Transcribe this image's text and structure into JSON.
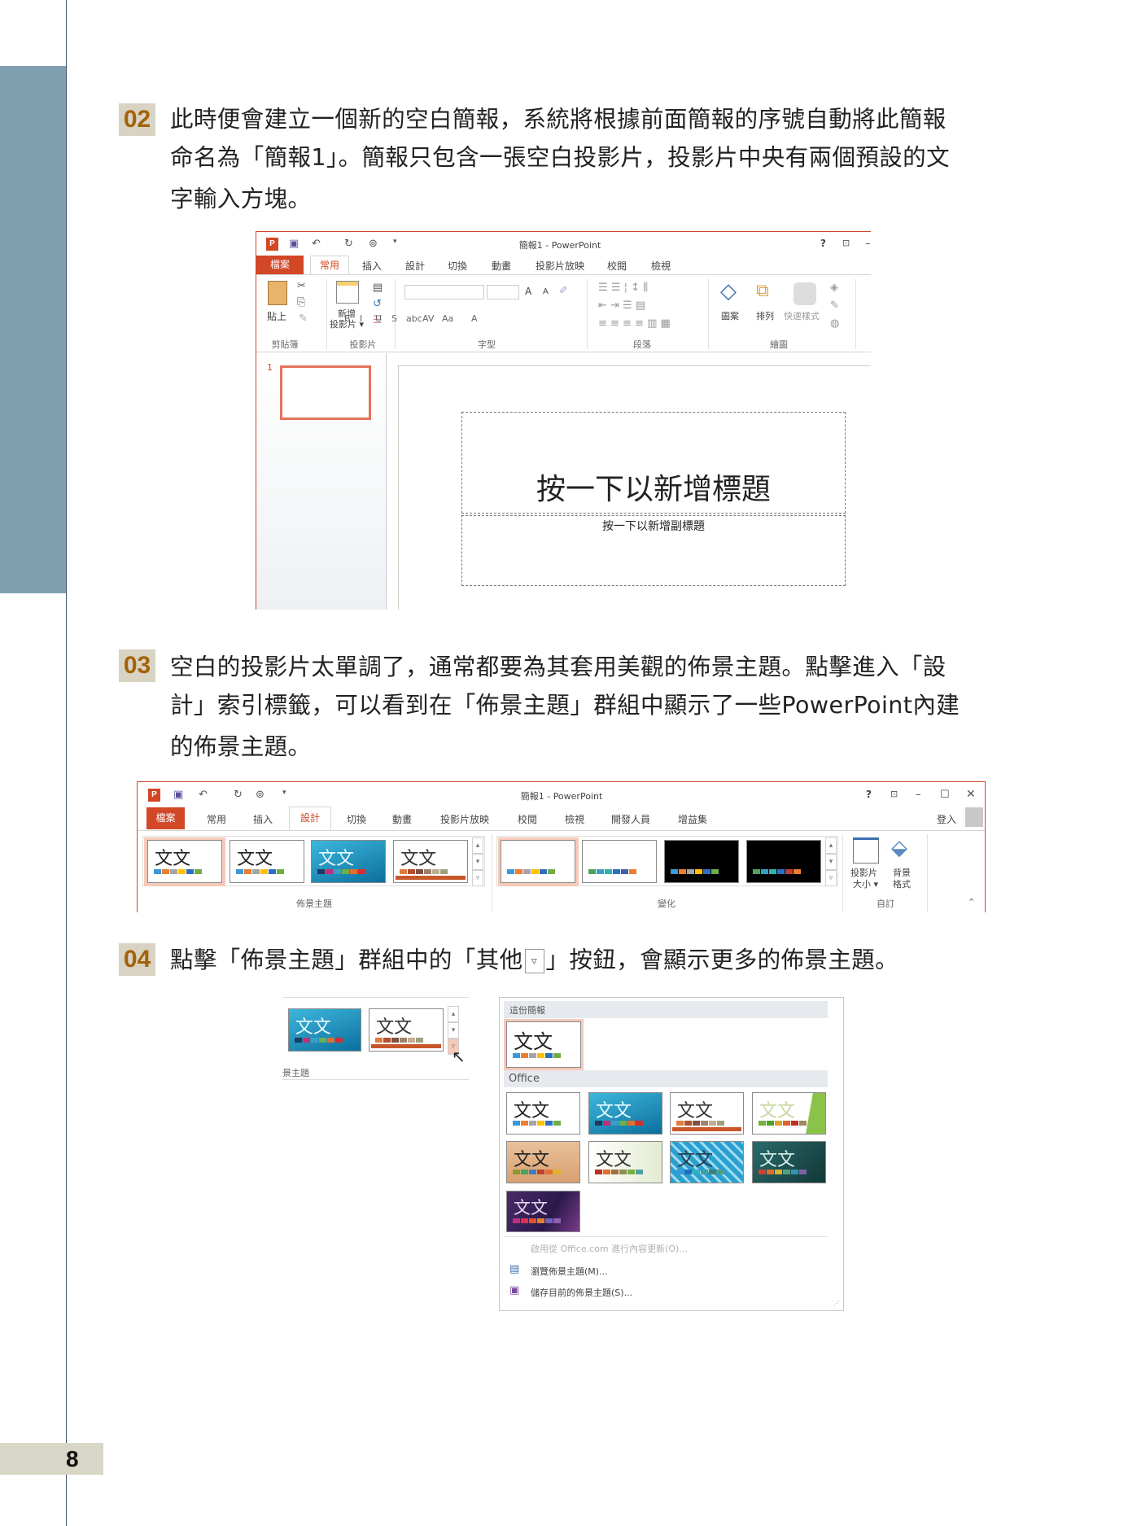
{
  "page_number": "8",
  "steps": [
    {
      "num": "02",
      "lines": [
        "此時便會建立一個新的空白簡報，系統將根據前面簡報的序號自動將此簡報",
        "命名為「簡報1」。簡報只包含一張空白投影片，投影片中央有兩個預設的文",
        "字輸入方塊。"
      ]
    },
    {
      "num": "03",
      "lines": [
        "空白的投影片太單調了，通常都要為其套用美觀的佈景主題。點擊進入「設",
        "計」索引標籤，可以看到在「佈景主題」群組中顯示了一些PowerPoint內建",
        "的佈景主題。"
      ]
    },
    {
      "num": "04",
      "before": "點擊「佈景主題」群組中的「其他",
      "more_icon": "▿",
      "after": "」按鈕，會顯示更多的佈景主題。"
    }
  ],
  "window1": {
    "title": "簡報1 - PowerPoint",
    "help": "?",
    "tabs": [
      "檔案",
      "常用",
      "插入",
      "設計",
      "切換",
      "動畫",
      "投影片放映",
      "校閱",
      "檢視"
    ],
    "active_tab": "常用",
    "ribbon": {
      "paste": "貼上",
      "new_slide_1": "新增",
      "new_slide_2": "投影片 ▾",
      "font_buttons": [
        "B",
        "I",
        "U",
        "S",
        "abc",
        "AV",
        "Aa",
        "A"
      ],
      "grow": "A",
      "shrink": "A",
      "shapes": "圖案",
      "arrange": "排列",
      "quick_styles": "快速樣式",
      "groups": [
        "剪貼簿",
        "投影片",
        "字型",
        "段落",
        "繪圖"
      ]
    },
    "slide_number": "1",
    "title_placeholder": "按一下以新增標題",
    "subtitle_placeholder": "按一下以新增副標題"
  },
  "window2": {
    "title": "簡報1 - PowerPoint",
    "help": "?",
    "tabs": [
      "檔案",
      "常用",
      "插入",
      "設計",
      "切換",
      "動畫",
      "投影片放映",
      "校閱",
      "檢視",
      "開發人員",
      "增益集"
    ],
    "active_tab": "設計",
    "sign_in": "登入",
    "slide_size_1": "投影片",
    "slide_size_2": "大小 ▾",
    "bg_format_1": "背景",
    "bg_format_2": "格式",
    "groups": [
      "佈景主題",
      "變化",
      "自訂"
    ]
  },
  "theme_label": "文文",
  "themes": {
    "office": {
      "bg": "#ffffff",
      "fg": "#222222",
      "sw": [
        "#3a9ad9",
        "#ed7d31",
        "#a5a5a5",
        "#ffc000",
        "#2f6fc0",
        "#70ad47"
      ]
    },
    "facet": {
      "bg": "linear-gradient(160deg,#3db7dc,#0c6f9e)",
      "fg": "#e6fbff",
      "sw": [
        "#1f3a5f",
        "#c0307a",
        "#3aa0c0",
        "#6bb04a",
        "#e07030",
        "#d03030"
      ]
    },
    "integral": {
      "bg": "#ffffff",
      "fg": "#333333",
      "sw": [
        "#e07a40",
        "#b05030",
        "#805040",
        "#a08070",
        "#c0b090",
        "#a0a080"
      ],
      "bar": "#c8582a"
    },
    "ion": {
      "bg": "linear-gradient(100deg,#ffffff 75%,#8bc34a 76%)",
      "fg": "#c8d8a0",
      "sw": [
        "#7ab040",
        "#50a030",
        "#e0a030",
        "#e06030",
        "#c03020",
        "#9a8a60"
      ]
    },
    "wood": {
      "bg": "linear-gradient(#e9c09a,#d9a070)",
      "fg": "#222222",
      "sw": [
        "#8a9a30",
        "#50a060",
        "#3a80c0",
        "#c04030",
        "#e07030",
        "#e0b030"
      ]
    },
    "retrospect": {
      "bg": "linear-gradient(90deg,#ffffff,#e3ebd0)",
      "fg": "#333333",
      "sw": [
        "#c03020",
        "#e07030",
        "#a07040",
        "#8a9050",
        "#7ab040",
        "#50a0a0"
      ]
    },
    "organic": {
      "bg": "repeating-linear-gradient(45deg,#2aa0d0 0 6px,#9fdcf0 6px 9px)",
      "fg": "#2a3a4a",
      "sw": [
        "#3a9ad9",
        "#1f70c0",
        "#30b0c0",
        "#40a0a0",
        "#408070",
        "#50a080"
      ]
    },
    "teal": {
      "bg": "linear-gradient(135deg,#2a6a6a,#123838)",
      "fg": "#d8eee8",
      "sw": [
        "#d04030",
        "#e07030",
        "#e0b030",
        "#50a080",
        "#3a90b0",
        "#8060a0"
      ]
    },
    "purple": {
      "bg": "linear-gradient(120deg,#4a2a6a,#2a1a4a 60%,#7a3a8a)",
      "fg": "#e8d8f0",
      "sw": [
        "#c03080",
        "#e03050",
        "#e05030",
        "#e08030",
        "#7060c0",
        "#9060b0"
      ]
    },
    "var1": {
      "bg": "#ffffff",
      "fg": "#222222",
      "sw": [
        "#3a9ad9",
        "#ed7d31",
        "#a5a5a5",
        "#ffc000",
        "#2f6fc0",
        "#70ad47"
      ],
      "notext": true
    },
    "var2": {
      "bg": "#ffffff",
      "fg": "#222222",
      "sw": [
        "#50a060",
        "#3aa0c0",
        "#30b0b0",
        "#2f6fc0",
        "#4060a0",
        "#ed7d31"
      ],
      "notext": true
    },
    "var3": {
      "bg": "#000000",
      "fg": "#ffffff",
      "sw": [
        "#3a9ad9",
        "#ed7d31",
        "#a5a5a5",
        "#ffc000",
        "#2f6fc0",
        "#70ad47"
      ],
      "notext": true
    },
    "var4": {
      "bg": "#000000",
      "fg": "#ffffff",
      "sw": [
        "#50a060",
        "#3aa0c0",
        "#30b0b0",
        "#2f6fc0",
        "#c04030",
        "#ed7d31"
      ],
      "notext": true
    }
  },
  "gallery": {
    "section_this": "這份簡報",
    "section_office": "Office",
    "menu": [
      {
        "label": "啟用從 Office.com 進行內容更新(O)...",
        "disabled": true
      },
      {
        "label": "瀏覽佈景主題(M)...",
        "icon": "browse-themes-icon"
      },
      {
        "label": "儲存目前的佈景主題(S)...",
        "icon": "save-theme-icon"
      }
    ],
    "crop_group_label": "景主題"
  },
  "colors": {
    "accent": "#d24726",
    "sidebar": "#7f9fb1",
    "badge_bg": "#d8d3c2",
    "badge_fg": "#a3620a"
  }
}
